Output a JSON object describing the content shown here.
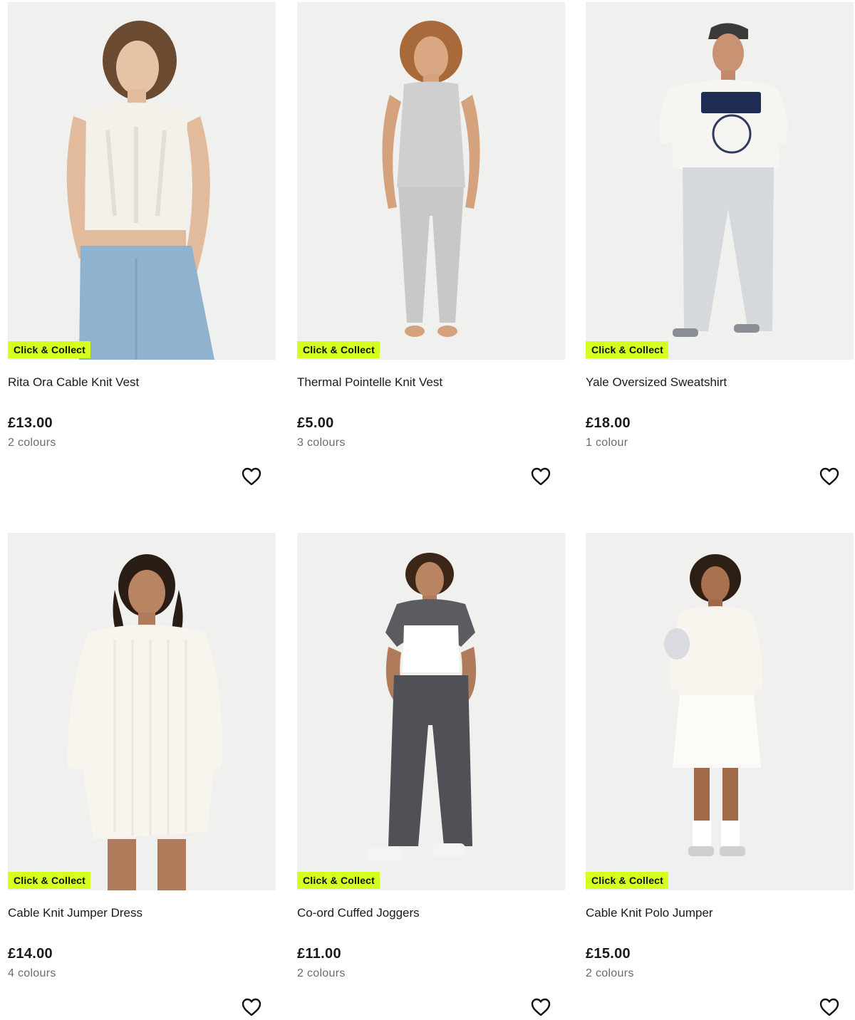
{
  "products": [
    {
      "title": "Rita Ora Cable Knit Vest",
      "price": "£13.00",
      "colours": "2 colours",
      "badge": "Click & Collect",
      "wishlist_icon": "heart-outline-icon"
    },
    {
      "title": "Thermal Pointelle Knit Vest",
      "price": "£5.00",
      "colours": "3 colours",
      "badge": "Click & Collect",
      "wishlist_icon": "heart-outline-icon"
    },
    {
      "title": "Yale Oversized Sweatshirt",
      "price": "£18.00",
      "colours": "1 colour",
      "badge": "Click & Collect",
      "wishlist_icon": "heart-outline-icon"
    },
    {
      "title": "Cable Knit Jumper Dress",
      "price": "£14.00",
      "colours": "4 colours",
      "badge": "Click & Collect",
      "wishlist_icon": "heart-outline-icon"
    },
    {
      "title": "Co-ord Cuffed Joggers",
      "price": "£11.00",
      "colours": "2 colours",
      "badge": "Click & Collect",
      "wishlist_icon": "heart-outline-icon"
    },
    {
      "title": "Cable Knit Polo Jumper",
      "price": "£15.00",
      "colours": "2 colours",
      "badge": "Click & Collect",
      "wishlist_icon": "heart-outline-icon"
    }
  ],
  "colors": {
    "badge_bg": "#d4ff1f",
    "image_bg": "#efefef",
    "muted_text": "#6b6b6b"
  }
}
